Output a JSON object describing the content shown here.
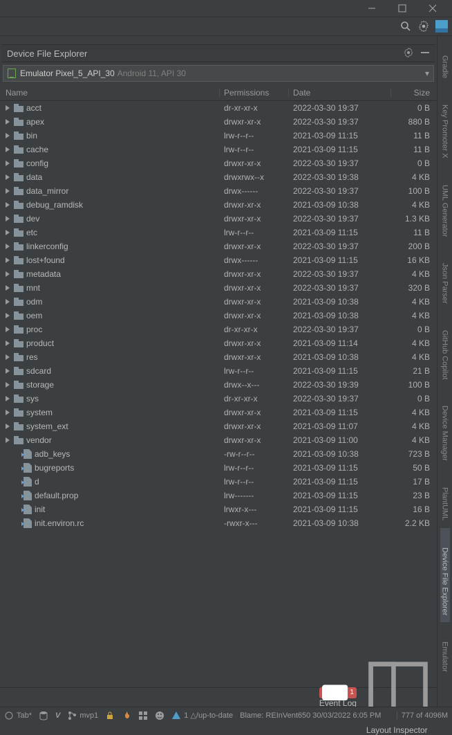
{
  "panel": {
    "title": "Device File Explorer"
  },
  "device": {
    "name": "Emulator Pixel_5_API_30",
    "subtitle": "Android 11, API 30"
  },
  "columns": {
    "name": "Name",
    "perm": "Permissions",
    "date": "Date",
    "size": "Size"
  },
  "rows": [
    {
      "kind": "dir",
      "name": "acct",
      "perm": "dr-xr-xr-x",
      "date": "2022-03-30 19:37",
      "size": "0 B"
    },
    {
      "kind": "dir",
      "name": "apex",
      "perm": "drwxr-xr-x",
      "date": "2022-03-30 19:37",
      "size": "880 B"
    },
    {
      "kind": "dir",
      "name": "bin",
      "perm": "lrw-r--r--",
      "date": "2021-03-09 11:15",
      "size": "11 B"
    },
    {
      "kind": "dir",
      "name": "cache",
      "perm": "lrw-r--r--",
      "date": "2021-03-09 11:15",
      "size": "11 B"
    },
    {
      "kind": "dir",
      "name": "config",
      "perm": "drwxr-xr-x",
      "date": "2022-03-30 19:37",
      "size": "0 B"
    },
    {
      "kind": "dir",
      "name": "data",
      "perm": "drwxrwx--x",
      "date": "2022-03-30 19:38",
      "size": "4 KB"
    },
    {
      "kind": "dir",
      "name": "data_mirror",
      "perm": "drwx------",
      "date": "2022-03-30 19:37",
      "size": "100 B"
    },
    {
      "kind": "dir",
      "name": "debug_ramdisk",
      "perm": "drwxr-xr-x",
      "date": "2021-03-09 10:38",
      "size": "4 KB"
    },
    {
      "kind": "dir",
      "name": "dev",
      "perm": "drwxr-xr-x",
      "date": "2022-03-30 19:37",
      "size": "1.3 KB"
    },
    {
      "kind": "dir",
      "name": "etc",
      "perm": "lrw-r--r--",
      "date": "2021-03-09 11:15",
      "size": "11 B"
    },
    {
      "kind": "dir",
      "name": "linkerconfig",
      "perm": "drwxr-xr-x",
      "date": "2022-03-30 19:37",
      "size": "200 B"
    },
    {
      "kind": "dir",
      "name": "lost+found",
      "perm": "drwx------",
      "date": "2021-03-09 11:15",
      "size": "16 KB"
    },
    {
      "kind": "dir",
      "name": "metadata",
      "perm": "drwxr-xr-x",
      "date": "2022-03-30 19:37",
      "size": "4 KB"
    },
    {
      "kind": "dir",
      "name": "mnt",
      "perm": "drwxr-xr-x",
      "date": "2022-03-30 19:37",
      "size": "320 B"
    },
    {
      "kind": "dir",
      "name": "odm",
      "perm": "drwxr-xr-x",
      "date": "2021-03-09 10:38",
      "size": "4 KB"
    },
    {
      "kind": "dir",
      "name": "oem",
      "perm": "drwxr-xr-x",
      "date": "2021-03-09 10:38",
      "size": "4 KB"
    },
    {
      "kind": "dir",
      "name": "proc",
      "perm": "dr-xr-xr-x",
      "date": "2022-03-30 19:37",
      "size": "0 B"
    },
    {
      "kind": "dir",
      "name": "product",
      "perm": "drwxr-xr-x",
      "date": "2021-03-09 11:14",
      "size": "4 KB"
    },
    {
      "kind": "dir",
      "name": "res",
      "perm": "drwxr-xr-x",
      "date": "2021-03-09 10:38",
      "size": "4 KB"
    },
    {
      "kind": "dir",
      "name": "sdcard",
      "perm": "lrw-r--r--",
      "date": "2021-03-09 11:15",
      "size": "21 B"
    },
    {
      "kind": "dir",
      "name": "storage",
      "perm": "drwx--x---",
      "date": "2022-03-30 19:39",
      "size": "100 B"
    },
    {
      "kind": "dir",
      "name": "sys",
      "perm": "dr-xr-xr-x",
      "date": "2022-03-30 19:37",
      "size": "0 B"
    },
    {
      "kind": "dir",
      "name": "system",
      "perm": "drwxr-xr-x",
      "date": "2021-03-09 11:15",
      "size": "4 KB"
    },
    {
      "kind": "dir",
      "name": "system_ext",
      "perm": "drwxr-xr-x",
      "date": "2021-03-09 11:07",
      "size": "4 KB"
    },
    {
      "kind": "dir",
      "name": "vendor",
      "perm": "drwxr-xr-x",
      "date": "2021-03-09 11:00",
      "size": "4 KB"
    },
    {
      "kind": "file",
      "name": "adb_keys",
      "perm": "-rw-r--r--",
      "date": "2021-03-09 10:38",
      "size": "723 B"
    },
    {
      "kind": "file",
      "name": "bugreports",
      "perm": "lrw-r--r--",
      "date": "2021-03-09 11:15",
      "size": "50 B"
    },
    {
      "kind": "file",
      "name": "d",
      "perm": "lrw-r--r--",
      "date": "2021-03-09 11:15",
      "size": "17 B"
    },
    {
      "kind": "file",
      "name": "default.prop",
      "perm": "lrw-------",
      "date": "2021-03-09 11:15",
      "size": "23 B"
    },
    {
      "kind": "file",
      "name": "init",
      "perm": "lrwxr-x---",
      "date": "2021-03-09 11:15",
      "size": "16 B"
    },
    {
      "kind": "file",
      "name": "init.environ.rc",
      "perm": "-rwxr-x---",
      "date": "2021-03-09 10:38",
      "size": "2.2 KB"
    }
  ],
  "rail": [
    {
      "label": "Gradle"
    },
    {
      "label": "Key Promoter X"
    },
    {
      "label": "UML Generator"
    },
    {
      "label": "Json Parser"
    },
    {
      "label": "GitHub Copilot"
    },
    {
      "label": "Device Manager"
    },
    {
      "label": "PlantUML"
    },
    {
      "label": "Device File Explorer",
      "active": true
    },
    {
      "label": "Emulator"
    }
  ],
  "status": {
    "tab": "Tab*",
    "mvp": "mvp1",
    "vcs": "1 △/up-to-date",
    "blame": "Blame: REInVent650 30/03/2022 6:05 PM",
    "mem": "777 of 4096M",
    "eventlog": "Event Log",
    "layout": "Layout Inspector"
  }
}
